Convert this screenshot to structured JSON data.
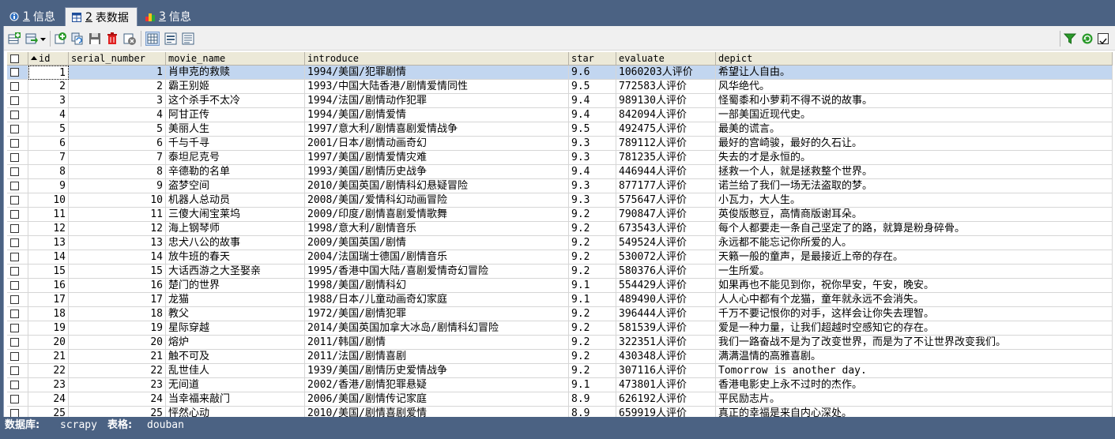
{
  "tabs": [
    {
      "num": "1",
      "label": "信息",
      "icon": "info-icon"
    },
    {
      "num": "2",
      "label": "表数据",
      "icon": "table-icon"
    },
    {
      "num": "3",
      "label": "信息",
      "icon": "bar-chart-icon"
    }
  ],
  "toolbar": {
    "icons": [
      "insert-row-icon",
      "export-icon",
      "dropdown-arrow-icon",
      "add-icon",
      "duplicate-icon",
      "save-icon",
      "delete-icon",
      "cancel-icon",
      "grid-view-icon",
      "form-view-icon",
      "text-view-icon",
      "filter-icon",
      "refresh-icon",
      "checkbox-icon"
    ]
  },
  "columns": [
    "id",
    "serial_number",
    "movie_name",
    "introduce",
    "star",
    "evaluate",
    "depict"
  ],
  "sort": {
    "column": "id",
    "direction": "asc"
  },
  "rows": [
    [
      "1",
      "1",
      "肖申克的救赎",
      "1994/美国/犯罪剧情",
      "9.6",
      "1060203人评价",
      "希望让人自由。"
    ],
    [
      "2",
      "2",
      "霸王别姬",
      "1993/中国大陆香港/剧情爱情同性",
      "9.5",
      "772583人评价",
      "风华绝代。"
    ],
    [
      "3",
      "3",
      "这个杀手不太冷",
      "1994/法国/剧情动作犯罪",
      "9.4",
      "989130人评价",
      "怪蜀黍和小萝莉不得不说的故事。"
    ],
    [
      "4",
      "4",
      "阿甘正传",
      "1994/美国/剧情爱情",
      "9.4",
      "842094人评价",
      "一部美国近现代史。"
    ],
    [
      "5",
      "5",
      "美丽人生",
      "1997/意大利/剧情喜剧爱情战争",
      "9.5",
      "492475人评价",
      "最美的谎言。"
    ],
    [
      "6",
      "6",
      "千与千寻",
      "2001/日本/剧情动画奇幻",
      "9.3",
      "789112人评价",
      "最好的宫崎骏，最好的久石让。"
    ],
    [
      "7",
      "7",
      "泰坦尼克号",
      "1997/美国/剧情爱情灾难",
      "9.3",
      "781235人评价",
      "失去的才是永恒的。"
    ],
    [
      "8",
      "8",
      "辛德勒的名单",
      "1993/美国/剧情历史战争",
      "9.4",
      "446944人评价",
      "拯救一个人，就是拯救整个世界。"
    ],
    [
      "9",
      "9",
      "盗梦空间",
      "2010/美国英国/剧情科幻悬疑冒险",
      "9.3",
      "877177人评价",
      "诺兰给了我们一场无法盗取的梦。"
    ],
    [
      "10",
      "10",
      "机器人总动员",
      "2008/美国/爱情科幻动画冒险",
      "9.3",
      "575647人评价",
      "小瓦力，大人生。"
    ],
    [
      "11",
      "11",
      "三傻大闹宝莱坞",
      "2009/印度/剧情喜剧爱情歌舞",
      "9.2",
      "790847人评价",
      "英俊版憨豆，高情商版谢耳朵。"
    ],
    [
      "12",
      "12",
      "海上钢琴师",
      "1998/意大利/剧情音乐",
      "9.2",
      "673543人评价",
      "每个人都要走一条自己坚定了的路，就算是粉身碎骨。"
    ],
    [
      "13",
      "13",
      "忠犬八公的故事",
      "2009/美国英国/剧情",
      "9.2",
      "549524人评价",
      "永远都不能忘记你所爱的人。"
    ],
    [
      "14",
      "14",
      "放牛班的春天",
      "2004/法国瑞士德国/剧情音乐",
      "9.2",
      "530072人评价",
      "天籁一般的童声，是最接近上帝的存在。"
    ],
    [
      "15",
      "15",
      "大话西游之大圣娶亲",
      "1995/香港中国大陆/喜剧爱情奇幻冒险",
      "9.2",
      "580376人评价",
      "一生所爱。"
    ],
    [
      "16",
      "16",
      "楚门的世界",
      "1998/美国/剧情科幻",
      "9.1",
      "554429人评价",
      "如果再也不能见到你，祝你早安，午安，晚安。"
    ],
    [
      "17",
      "17",
      "龙猫",
      "1988/日本/儿童动画奇幻家庭",
      "9.1",
      "489490人评价",
      "人人心中都有个龙猫，童年就永远不会消失。"
    ],
    [
      "18",
      "18",
      "教父",
      "1972/美国/剧情犯罪",
      "9.2",
      "396444人评价",
      "千万不要记恨你的对手，这样会让你失去理智。"
    ],
    [
      "19",
      "19",
      "星际穿越",
      "2014/美国英国加拿大冰岛/剧情科幻冒险",
      "9.2",
      "581539人评价",
      "爱是一种力量，让我们超越时空感知它的存在。"
    ],
    [
      "20",
      "20",
      "熔炉",
      "2011/韩国/剧情",
      "9.2",
      "322351人评价",
      "我们一路奋战不是为了改变世界，而是为了不让世界改变我们。"
    ],
    [
      "21",
      "21",
      "触不可及",
      "2011/法国/剧情喜剧",
      "9.2",
      "430348人评价",
      "满满温情的高雅喜剧。"
    ],
    [
      "22",
      "22",
      "乱世佳人",
      "1939/美国/剧情历史爱情战争",
      "9.2",
      "307116人评价",
      "Tomorrow is another day."
    ],
    [
      "23",
      "23",
      "无间道",
      "2002/香港/剧情犯罪悬疑",
      "9.1",
      "473801人评价",
      "香港电影史上永不过时的杰作。"
    ],
    [
      "24",
      "24",
      "当幸福来敲门",
      "2006/美国/剧情传记家庭",
      "8.9",
      "626192人评价",
      "平民励志片。"
    ],
    [
      "25",
      "25",
      "怦然心动",
      "2010/美国/剧情喜剧爱情",
      "8.9",
      "659919人评价",
      "真正的幸福是来自内心深处。"
    ]
  ],
  "status": {
    "db_label": "数据库:",
    "db_value": "scrapy",
    "table_label": "表格:",
    "table_value": "douban"
  }
}
